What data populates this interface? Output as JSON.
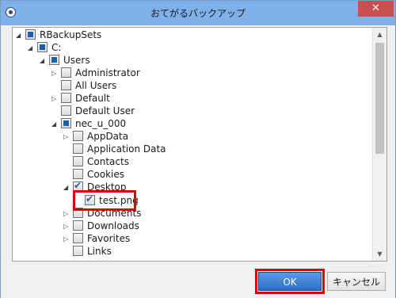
{
  "window": {
    "title": "おてがるバックアップ",
    "close_symbol": "✕"
  },
  "tree": {
    "items": [
      {
        "label": "RBackupSets",
        "state": "partial",
        "expander": "◢"
      },
      {
        "label": "C:",
        "state": "partial",
        "expander": "◢"
      },
      {
        "label": "Users",
        "state": "partial",
        "expander": "◢"
      },
      {
        "label": "Administrator",
        "state": "unchecked",
        "expander": "▷"
      },
      {
        "label": "All Users",
        "state": "unchecked",
        "expander": ""
      },
      {
        "label": "Default",
        "state": "unchecked",
        "expander": "▷"
      },
      {
        "label": "Default User",
        "state": "unchecked",
        "expander": ""
      },
      {
        "label": "nec_u_000",
        "state": "partial",
        "expander": "◢"
      },
      {
        "label": "AppData",
        "state": "unchecked",
        "expander": "▷"
      },
      {
        "label": "Application Data",
        "state": "unchecked",
        "expander": ""
      },
      {
        "label": "Contacts",
        "state": "unchecked",
        "expander": ""
      },
      {
        "label": "Cookies",
        "state": "unchecked",
        "expander": ""
      },
      {
        "label": "Desktop",
        "state": "checked",
        "expander": "◢"
      },
      {
        "label": "test.png",
        "state": "checked",
        "expander": ""
      },
      {
        "label": "Documents",
        "state": "unchecked",
        "expander": "▷"
      },
      {
        "label": "Downloads",
        "state": "unchecked",
        "expander": "▷"
      },
      {
        "label": "Favorites",
        "state": "unchecked",
        "expander": "▷"
      },
      {
        "label": "Links",
        "state": "unchecked",
        "expander": ""
      }
    ]
  },
  "buttons": {
    "ok": "OK",
    "cancel": "キャンセル"
  }
}
